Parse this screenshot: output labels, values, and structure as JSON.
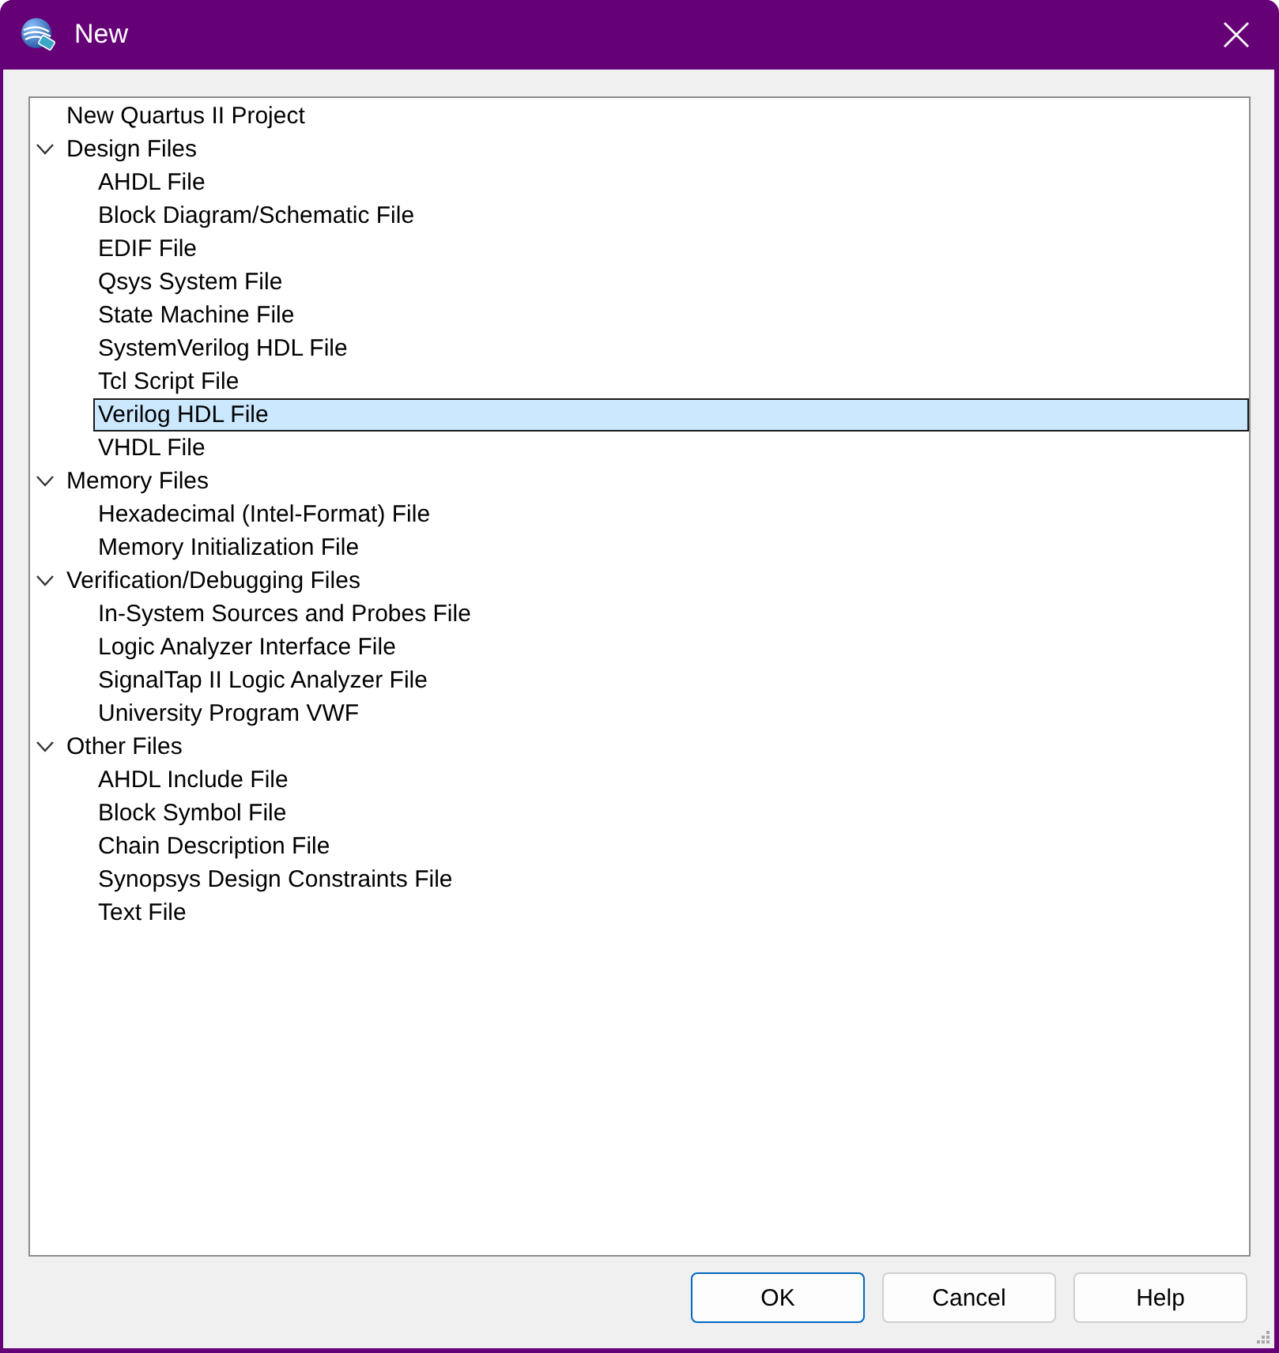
{
  "window": {
    "title": "New"
  },
  "tree": [
    {
      "label": "New Quartus II Project",
      "selected": false
    },
    {
      "label": "Design Files",
      "expanded": true,
      "selected": false,
      "children": [
        {
          "label": "AHDL File",
          "selected": false
        },
        {
          "label": "Block Diagram/Schematic File",
          "selected": false
        },
        {
          "label": "EDIF File",
          "selected": false
        },
        {
          "label": "Qsys System File",
          "selected": false
        },
        {
          "label": "State Machine File",
          "selected": false
        },
        {
          "label": "SystemVerilog HDL File",
          "selected": false
        },
        {
          "label": "Tcl Script File",
          "selected": false
        },
        {
          "label": "Verilog HDL File",
          "selected": true
        },
        {
          "label": "VHDL File",
          "selected": false
        }
      ]
    },
    {
      "label": "Memory Files",
      "expanded": true,
      "selected": false,
      "children": [
        {
          "label": "Hexadecimal (Intel-Format) File",
          "selected": false
        },
        {
          "label": "Memory Initialization File",
          "selected": false
        }
      ]
    },
    {
      "label": "Verification/Debugging Files",
      "expanded": true,
      "selected": false,
      "children": [
        {
          "label": "In-System Sources and Probes File",
          "selected": false
        },
        {
          "label": "Logic Analyzer Interface File",
          "selected": false
        },
        {
          "label": "SignalTap II Logic Analyzer File",
          "selected": false
        },
        {
          "label": "University Program VWF",
          "selected": false
        }
      ]
    },
    {
      "label": "Other Files",
      "expanded": true,
      "selected": false,
      "children": [
        {
          "label": "AHDL Include File",
          "selected": false
        },
        {
          "label": "Block Symbol File",
          "selected": false
        },
        {
          "label": "Chain Description File",
          "selected": false
        },
        {
          "label": "Synopsys Design Constraints File",
          "selected": false
        },
        {
          "label": "Text File",
          "selected": false
        }
      ]
    }
  ],
  "buttons": [
    {
      "label": "OK",
      "default": true
    },
    {
      "label": "Cancel",
      "default": false
    },
    {
      "label": "Help",
      "default": false
    }
  ]
}
